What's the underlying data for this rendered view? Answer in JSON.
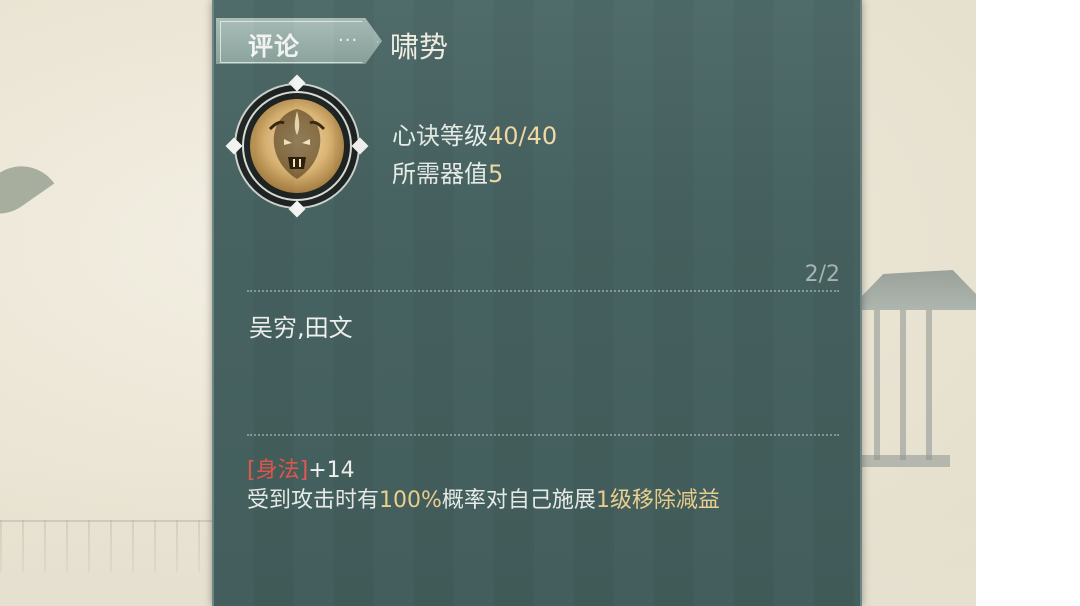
{
  "header": {
    "tab_label": "评论",
    "more_label": "···",
    "skill_name": "啸势"
  },
  "emblem": {
    "icon": "beast-face-icon"
  },
  "stats": {
    "level_label": "心诀等级",
    "level_value": "40/40",
    "cost_label": "所需器值",
    "cost_value": "5"
  },
  "page_count": "2/2",
  "names": "吴穷,田文",
  "attribute": {
    "open_bracket": "[",
    "name": "身法",
    "close_bracket": "]",
    "bonus": "+14"
  },
  "effect": {
    "part1": "受到攻击时有",
    "chance": "100%",
    "part2": "概率对自己施展",
    "level": "1级移除减益"
  },
  "colors": {
    "panel": "#45615f",
    "accent_gold": "#efd9a6",
    "attribute_red": "#e0574b"
  }
}
